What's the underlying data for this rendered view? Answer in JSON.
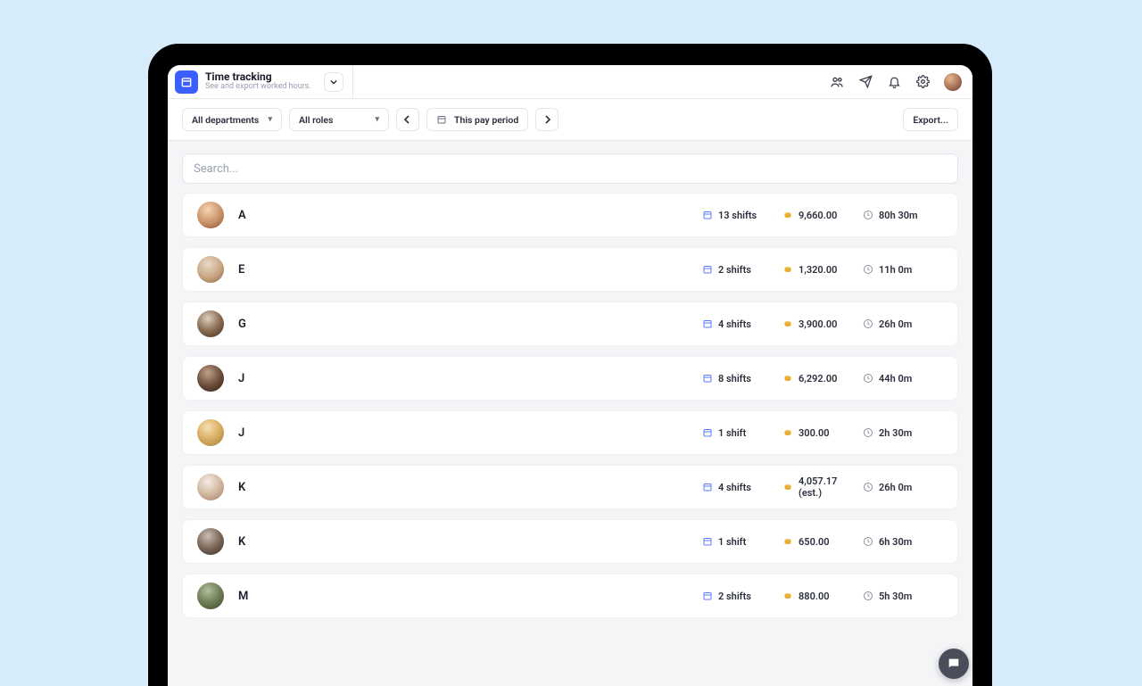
{
  "header": {
    "title": "Time tracking",
    "subtitle": "See and export worked hours."
  },
  "filters": {
    "departments": "All departments",
    "roles": "All roles",
    "period": "This pay period",
    "export": "Export..."
  },
  "search": {
    "placeholder": "Search..."
  },
  "rows": [
    {
      "name": "A",
      "shifts": "13 shifts",
      "pay": "9,660.00",
      "hours": "80h 30m"
    },
    {
      "name": "E",
      "shifts": "2 shifts",
      "pay": "1,320.00",
      "hours": "11h 0m"
    },
    {
      "name": "G",
      "shifts": "4 shifts",
      "pay": "3,900.00",
      "hours": "26h 0m"
    },
    {
      "name": "J",
      "shifts": "8 shifts",
      "pay": "6,292.00",
      "hours": "44h 0m"
    },
    {
      "name": "J",
      "shifts": "1 shift",
      "pay": "300.00",
      "hours": "2h 30m"
    },
    {
      "name": "K",
      "shifts": "4 shifts",
      "pay": "4,057.17 (est.)",
      "hours": "26h 0m"
    },
    {
      "name": "K",
      "shifts": "1 shift",
      "pay": "650.00",
      "hours": "6h 30m"
    },
    {
      "name": "M",
      "shifts": "2 shifts",
      "pay": "880.00",
      "hours": "5h 30m"
    }
  ]
}
